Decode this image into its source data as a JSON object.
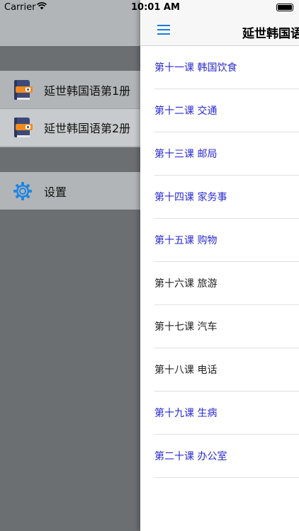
{
  "status_bar": {
    "carrier": "Carrier",
    "time": "10:01 AM"
  },
  "drawer": {
    "books": [
      {
        "label": "延世韩国语第1册",
        "icon": "book-icon",
        "selected": false
      },
      {
        "label": "延世韩国语第2册",
        "icon": "book-icon",
        "selected": true
      }
    ],
    "settings": {
      "label": "设置",
      "icon": "gear-icon"
    }
  },
  "navbar": {
    "menu_icon": "hamburger-icon",
    "title": "延世韩国语"
  },
  "lessons": [
    {
      "label": "第十一课 韩国饮食",
      "color": "#2a2ad0"
    },
    {
      "label": "第十二课 交通",
      "color": "#2a2ad0"
    },
    {
      "label": "第十三课 邮局",
      "color": "#2a2ad0"
    },
    {
      "label": "第十四课 家务事",
      "color": "#2a2ad0"
    },
    {
      "label": "第十五课 购物",
      "color": "#2a2ad0"
    },
    {
      "label": "第十六课 旅游",
      "color": "#222222"
    },
    {
      "label": "第十七课 汽车",
      "color": "#222222"
    },
    {
      "label": "第十八课 电话",
      "color": "#222222"
    },
    {
      "label": "第十九课 生病",
      "color": "#2a2ad0"
    },
    {
      "label": "第二十课 办公室",
      "color": "#2a2ad0"
    }
  ]
}
